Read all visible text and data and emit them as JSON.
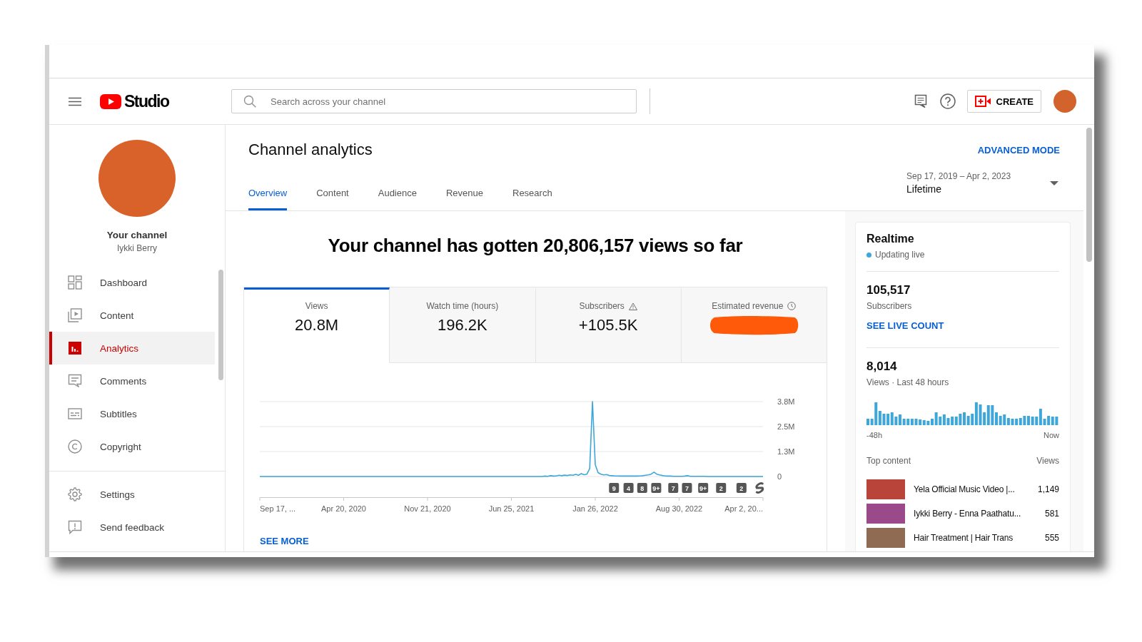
{
  "top_bar": {
    "logo": "Studio",
    "search": {
      "placeholder": "Search across your channel"
    },
    "create_button": "CREATE"
  },
  "sidebar": {
    "channel": {
      "label": "Your channel",
      "name": "Iykki Berry"
    },
    "items": [
      {
        "label": "Dashboard",
        "selected": false
      },
      {
        "label": "Content",
        "selected": false
      },
      {
        "label": "Analytics",
        "selected": true
      },
      {
        "label": "Comments",
        "selected": false
      },
      {
        "label": "Subtitles",
        "selected": false
      },
      {
        "label": "Copyright",
        "selected": false
      }
    ],
    "footer_items": [
      {
        "label": "Settings",
        "selected": false
      },
      {
        "label": "Send feedback",
        "selected": false
      }
    ]
  },
  "page": {
    "title": "Channel analytics",
    "advanced_mode": "ADVANCED MODE",
    "tabs": [
      {
        "label": "Overview",
        "selected": true
      },
      {
        "label": "Content",
        "selected": false
      },
      {
        "label": "Audience",
        "selected": false
      },
      {
        "label": "Revenue",
        "selected": false
      },
      {
        "label": "Research",
        "selected": false
      }
    ],
    "date_range": {
      "dates": "Sep 17, 2019 – Apr 2, 2023",
      "period": "Lifetime"
    }
  },
  "overview": {
    "headline": "Your channel has gotten 20,806,157 views so far",
    "metrics": [
      {
        "kind": "value",
        "label": "Views",
        "value": "20.8M",
        "selected": true
      },
      {
        "kind": "value",
        "label": "Watch time (hours)",
        "value": "196.2K",
        "selected": false
      },
      {
        "kind": "value",
        "label": "Subscribers",
        "value": "+105.5K",
        "selected": false
      },
      {
        "kind": "redacted",
        "label": "Estimated revenue",
        "selected": false
      }
    ],
    "chart_range": {
      "start": "Sep 17, ...",
      "end": "Apr 2, 20..."
    },
    "chart_data": {
      "type": "line",
      "categories": [
        null,
        null,
        null,
        null,
        null,
        null,
        null,
        null,
        null,
        null,
        null,
        null,
        null,
        null,
        null,
        null,
        null,
        null,
        null,
        null,
        null,
        null,
        null,
        null,
        null,
        null,
        null,
        null,
        null,
        null,
        "Apr 20, 2020",
        null,
        null,
        null,
        null,
        null,
        null,
        null,
        null,
        null,
        null,
        null,
        null,
        null,
        null,
        null,
        null,
        null,
        null,
        null,
        null,
        null,
        null,
        null,
        null,
        null,
        null,
        null,
        null,
        null,
        "Nov 21, 2020",
        null,
        null,
        null,
        null,
        null,
        null,
        null,
        null,
        null,
        null,
        null,
        null,
        null,
        null,
        null,
        null,
        null,
        null,
        null,
        null,
        null,
        null,
        null,
        null,
        null,
        null,
        null,
        null,
        null,
        "Jun 25, 2021",
        null,
        null,
        null,
        null,
        null,
        null,
        null,
        null,
        null,
        null,
        null,
        null,
        null,
        null,
        null,
        null,
        null,
        null,
        null,
        null,
        null,
        null,
        null,
        null,
        null,
        null,
        null,
        null,
        null,
        "Jan 26, 2022",
        null,
        null,
        null,
        null,
        null,
        null,
        null,
        null,
        null,
        null,
        null,
        null,
        null,
        null,
        null,
        null,
        null,
        null,
        null,
        null,
        null,
        null,
        null,
        null,
        null,
        null,
        null,
        null,
        null,
        "Aug 30, 2022",
        null,
        null,
        null,
        null,
        null,
        null,
        null,
        null,
        null,
        null,
        null,
        null,
        null,
        null,
        null,
        null,
        null,
        null,
        null,
        null,
        null,
        null,
        null,
        null,
        null,
        null,
        null,
        null,
        null,
        null
      ],
      "series": [
        {
          "color": "#3ea6d9",
          "values": [
            0,
            0,
            0,
            0,
            0,
            0,
            0,
            0,
            0,
            0,
            0,
            0,
            0,
            0,
            0,
            0,
            0,
            0,
            0,
            0,
            0,
            0,
            0,
            0,
            0,
            0,
            0,
            0,
            0,
            0,
            0,
            0,
            0,
            0,
            0,
            0,
            0,
            0,
            0,
            0,
            0,
            0,
            0,
            0,
            0,
            0,
            0,
            0,
            0,
            0,
            0,
            0,
            0,
            0,
            0,
            0,
            0,
            0,
            0,
            0,
            0,
            0,
            0,
            0,
            0,
            0,
            0,
            0,
            0,
            0,
            0,
            0,
            0,
            0,
            0,
            0,
            0,
            0,
            0,
            0,
            0,
            0,
            0,
            0,
            0,
            0,
            0,
            0,
            0,
            0,
            0,
            0,
            0,
            0,
            0,
            0,
            0,
            0,
            0,
            0,
            0,
            0,
            20000,
            10000,
            40000,
            20000,
            30000,
            60000,
            40000,
            70000,
            50000,
            80000,
            60000,
            110000,
            60000,
            150000,
            90000,
            120000,
            400000,
            3800000,
            600000,
            200000,
            120000,
            80000,
            100000,
            50000,
            40000,
            30000,
            30000,
            20000,
            20000,
            20000,
            30000,
            20000,
            30000,
            20000,
            30000,
            40000,
            60000,
            80000,
            120000,
            220000,
            120000,
            80000,
            50000,
            30000,
            20000,
            20000,
            10000,
            10000,
            10000,
            10000,
            20000,
            40000,
            10000,
            10000,
            10000,
            10000,
            10000,
            10000,
            0,
            0,
            0,
            0,
            0,
            0,
            0,
            0,
            0,
            0,
            0,
            0,
            0,
            0,
            0,
            0,
            0,
            0,
            0,
            0,
            0
          ]
        }
      ],
      "ylim": [
        0,
        3800000
      ],
      "yticks": [
        {
          "value": 0,
          "label": "0"
        },
        {
          "value": 1266667,
          "label": "1.3M"
        },
        {
          "value": 2533333,
          "label": "2.5M"
        },
        {
          "value": 3800000,
          "label": "3.8M"
        }
      ],
      "annotations": [
        "9",
        "4",
        "8",
        "9+",
        "7",
        "7",
        "9+",
        "2",
        "2"
      ]
    },
    "see_more": "SEE MORE"
  },
  "realtime": {
    "title": "Realtime",
    "status": "Updating live",
    "subscribers": {
      "value": "105,517",
      "label": "Subscribers",
      "link": "SEE LIVE COUNT"
    },
    "views": {
      "value": "8,014",
      "label": "Views · Last 48 hours",
      "axis_start": "-48h",
      "axis_end": "Now"
    },
    "top_content": {
      "heading": "Top content",
      "views_heading": "Views",
      "rows": [
        {
          "title": "Yela Official Music Video |...",
          "views": "1,149"
        },
        {
          "title": "Iykki Berry - Enna Paathatu...",
          "views": "581"
        },
        {
          "title": "Hair Treatment | Hair Trans",
          "views": "555"
        }
      ]
    }
  }
}
